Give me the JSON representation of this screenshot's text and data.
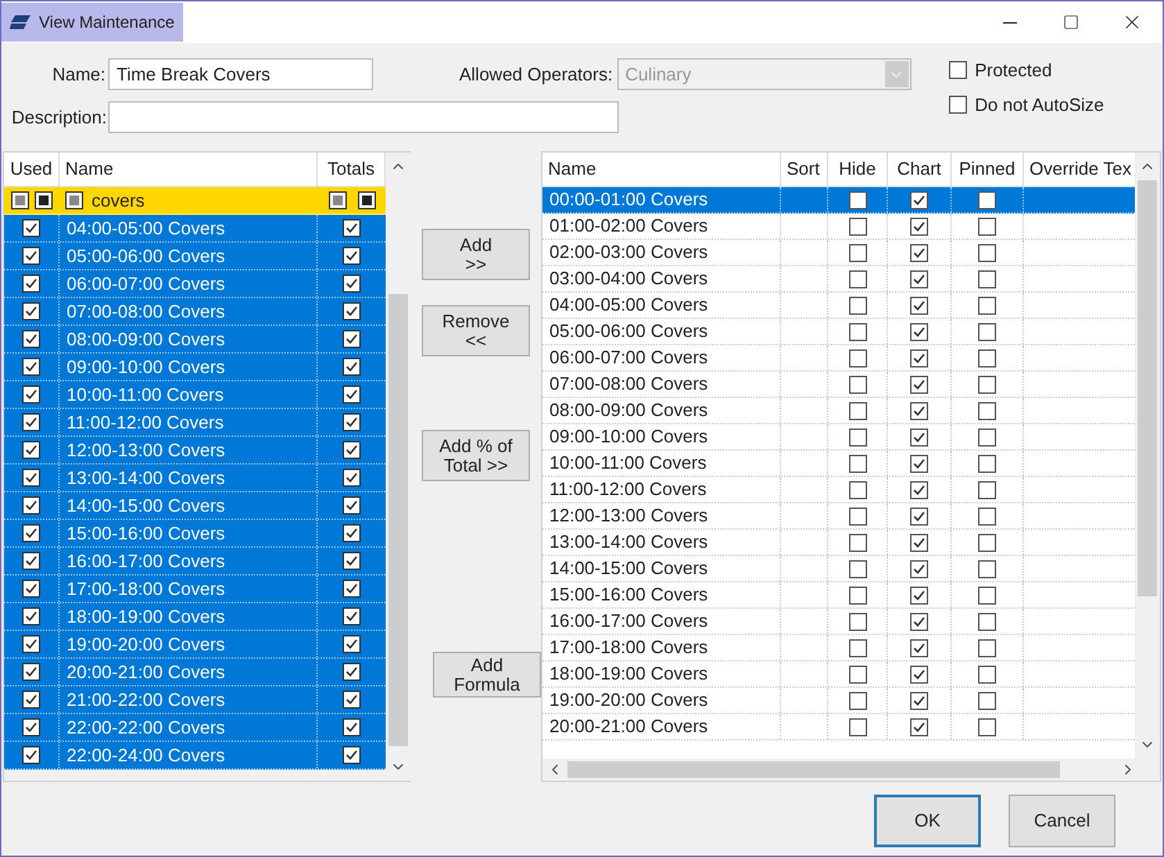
{
  "window": {
    "title": "View Maintenance"
  },
  "form": {
    "name_label": "Name:",
    "name_value": "Time Break Covers",
    "operators_label": "Allowed Operators:",
    "operators_value": "Culinary",
    "operators_disabled": true,
    "description_label": "Description:",
    "options": [
      {
        "label": "Protected",
        "checked": false
      },
      {
        "label": "Do not AutoSize",
        "checked": false
      }
    ]
  },
  "left_table": {
    "columns": [
      "Used",
      "Name",
      "Totals"
    ],
    "rows": [
      {
        "kind": "group",
        "name": "covers",
        "checks": [
          {
            "kind": "mixed",
            "checked": true
          },
          {
            "kind": "filled",
            "checked": true
          },
          {
            "kind": "mixed",
            "checked": true
          },
          {
            "kind": "mixed",
            "checked": true
          },
          {
            "kind": "filled",
            "checked": true
          }
        ]
      },
      {
        "kind": "item",
        "name": "04:00-05:00 Covers",
        "used": true,
        "totals": true,
        "selected": true
      },
      {
        "kind": "item",
        "name": "05:00-06:00 Covers",
        "used": true,
        "totals": true,
        "selected": true
      },
      {
        "kind": "item",
        "name": "06:00-07:00 Covers",
        "used": true,
        "totals": true,
        "selected": true
      },
      {
        "kind": "item",
        "name": "07:00-08:00 Covers",
        "used": true,
        "totals": true,
        "selected": true
      },
      {
        "kind": "item",
        "name": "08:00-09:00 Covers",
        "used": true,
        "totals": true,
        "selected": true
      },
      {
        "kind": "item",
        "name": "09:00-10:00 Covers",
        "used": true,
        "totals": true,
        "selected": true
      },
      {
        "kind": "item",
        "name": "10:00-11:00 Covers",
        "used": true,
        "totals": true,
        "selected": true
      },
      {
        "kind": "item",
        "name": "11:00-12:00 Covers",
        "used": true,
        "totals": true,
        "selected": true
      },
      {
        "kind": "item",
        "name": "12:00-13:00 Covers",
        "used": true,
        "totals": true,
        "selected": true
      },
      {
        "kind": "item",
        "name": "13:00-14:00 Covers",
        "used": true,
        "totals": true,
        "selected": true
      },
      {
        "kind": "item",
        "name": "14:00-15:00 Covers",
        "used": true,
        "totals": true,
        "selected": true
      },
      {
        "kind": "item",
        "name": "15:00-16:00 Covers",
        "used": true,
        "totals": true,
        "selected": true
      },
      {
        "kind": "item",
        "name": "16:00-17:00 Covers",
        "used": true,
        "totals": true,
        "selected": true
      },
      {
        "kind": "item",
        "name": "17:00-18:00 Covers",
        "used": true,
        "totals": true,
        "selected": true
      },
      {
        "kind": "item",
        "name": "18:00-19:00 Covers",
        "used": true,
        "totals": true,
        "selected": true
      },
      {
        "kind": "item",
        "name": "19:00-20:00 Covers",
        "used": true,
        "totals": true,
        "selected": true
      },
      {
        "kind": "item",
        "name": "20:00-21:00 Covers",
        "used": true,
        "totals": true,
        "selected": true
      },
      {
        "kind": "item",
        "name": "21:00-22:00 Covers",
        "used": true,
        "totals": true,
        "selected": true
      },
      {
        "kind": "item",
        "name": "22:00-22:00 Covers",
        "used": true,
        "totals": true,
        "selected": true
      },
      {
        "kind": "item",
        "name": "22:00-24:00 Covers",
        "used": true,
        "totals": true,
        "selected": true
      }
    ]
  },
  "middle_buttons": [
    {
      "lines": [
        "Add",
        ">>"
      ]
    },
    {
      "lines": [
        "Remove",
        "<<"
      ]
    },
    {
      "lines": [
        "Add % of",
        "Total >>"
      ]
    },
    {
      "lines": [
        "Add",
        "Formula"
      ]
    }
  ],
  "right_table": {
    "columns": [
      "Name",
      "Sort",
      "Hide",
      "Chart",
      "Pinned",
      "Override Tex"
    ],
    "rows": [
      {
        "name": "00:00-01:00 Covers",
        "hide": false,
        "chart": true,
        "pinned": false,
        "selected": true
      },
      {
        "name": "01:00-02:00 Covers",
        "hide": false,
        "chart": true,
        "pinned": false,
        "selected": false
      },
      {
        "name": "02:00-03:00 Covers",
        "hide": false,
        "chart": true,
        "pinned": false,
        "selected": false
      },
      {
        "name": "03:00-04:00 Covers",
        "hide": false,
        "chart": true,
        "pinned": false,
        "selected": false
      },
      {
        "name": "04:00-05:00 Covers",
        "hide": false,
        "chart": true,
        "pinned": false,
        "selected": false
      },
      {
        "name": "05:00-06:00 Covers",
        "hide": false,
        "chart": true,
        "pinned": false,
        "selected": false
      },
      {
        "name": "06:00-07:00 Covers",
        "hide": false,
        "chart": true,
        "pinned": false,
        "selected": false
      },
      {
        "name": "07:00-08:00 Covers",
        "hide": false,
        "chart": true,
        "pinned": false,
        "selected": false
      },
      {
        "name": "08:00-09:00 Covers",
        "hide": false,
        "chart": true,
        "pinned": false,
        "selected": false
      },
      {
        "name": "09:00-10:00 Covers",
        "hide": false,
        "chart": true,
        "pinned": false,
        "selected": false
      },
      {
        "name": "10:00-11:00 Covers",
        "hide": false,
        "chart": true,
        "pinned": false,
        "selected": false
      },
      {
        "name": "11:00-12:00 Covers",
        "hide": false,
        "chart": true,
        "pinned": false,
        "selected": false
      },
      {
        "name": "12:00-13:00 Covers",
        "hide": false,
        "chart": true,
        "pinned": false,
        "selected": false
      },
      {
        "name": "13:00-14:00 Covers",
        "hide": false,
        "chart": true,
        "pinned": false,
        "selected": false
      },
      {
        "name": "14:00-15:00 Covers",
        "hide": false,
        "chart": true,
        "pinned": false,
        "selected": false
      },
      {
        "name": "15:00-16:00 Covers",
        "hide": false,
        "chart": true,
        "pinned": false,
        "selected": false
      },
      {
        "name": "16:00-17:00 Covers",
        "hide": false,
        "chart": true,
        "pinned": false,
        "selected": false
      },
      {
        "name": "17:00-18:00 Covers",
        "hide": false,
        "chart": true,
        "pinned": false,
        "selected": false
      },
      {
        "name": "18:00-19:00 Covers",
        "hide": false,
        "chart": true,
        "pinned": false,
        "selected": false
      },
      {
        "name": "19:00-20:00 Covers",
        "hide": false,
        "chart": true,
        "pinned": false,
        "selected": false
      },
      {
        "name": "20:00-21:00 Covers",
        "hide": false,
        "chart": true,
        "pinned": false,
        "selected": false
      }
    ]
  },
  "footer_buttons": [
    {
      "label": "OK",
      "default": true
    },
    {
      "label": "Cancel",
      "default": false
    }
  ]
}
